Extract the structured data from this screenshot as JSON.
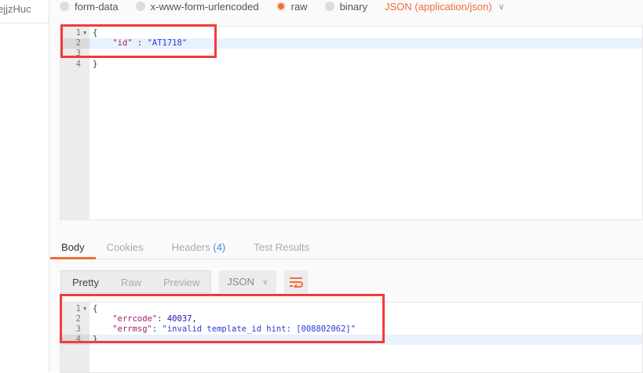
{
  "sidebar": {
    "item_text": "ejjzHuc"
  },
  "body_modes": [
    {
      "label": "form-data",
      "selected": false
    },
    {
      "label": "x-www-form-urlencoded",
      "selected": false
    },
    {
      "label": "raw",
      "selected": true
    },
    {
      "label": "binary",
      "selected": false
    }
  ],
  "content_type": {
    "label": "JSON (application/json)"
  },
  "request_editor": {
    "line_numbers": [
      "1",
      "2",
      "3",
      "4"
    ],
    "lines": [
      "{",
      "\"id\" : \"AT1718\"",
      "",
      "}"
    ],
    "key": "\"id\"",
    "sep": " : ",
    "value": "\"AT1718\""
  },
  "response_tabs": {
    "body": "Body",
    "cookies": "Cookies",
    "headers": "Headers",
    "headers_count": "(4)",
    "tests": "Test Results"
  },
  "response_toolbar": {
    "pretty": "Pretty",
    "raw": "Raw",
    "preview": "Preview",
    "format": "JSON"
  },
  "response_editor": {
    "line_numbers": [
      "1",
      "2",
      "3",
      "4"
    ],
    "open": "{",
    "close": "}",
    "errcode_key": "\"errcode\"",
    "errcode_val": "40037",
    "errmsg_key": "\"errmsg\"",
    "errmsg_val": "\"invalid template_id hint: [008802062]\""
  },
  "colors": {
    "accent": "#f26b3a",
    "highlight_box": "#f23b3b",
    "count": "#3a8ee6"
  }
}
